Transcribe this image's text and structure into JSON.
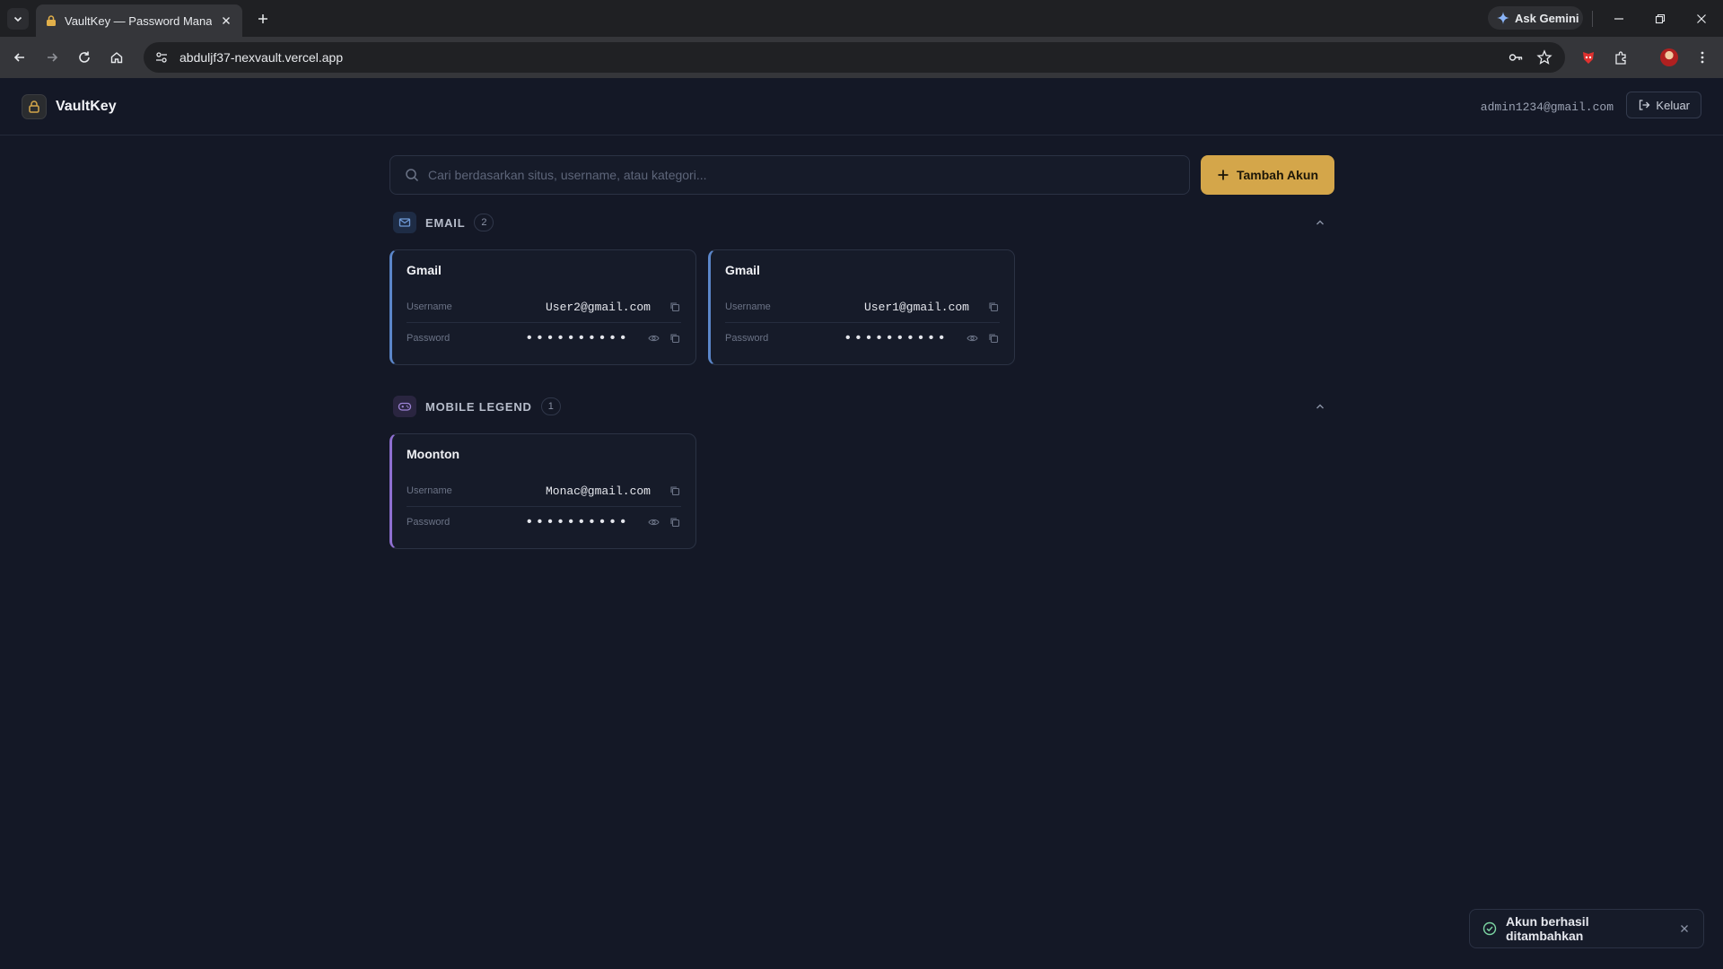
{
  "browser": {
    "tab_title": "VaultKey — Password Manager",
    "url": "abduljf37-nexvault.vercel.app",
    "gemini_label": "Ask Gemini"
  },
  "header": {
    "brand": "VaultKey",
    "user_email": "admin1234@gmail.com",
    "logout_label": "Keluar"
  },
  "search": {
    "placeholder": "Cari berdasarkan situs, username, atau kategori..."
  },
  "add_button_label": "Tambah Akun",
  "labels": {
    "username": "Username",
    "password": "Password"
  },
  "sections": [
    {
      "title": "EMAIL",
      "count": "2",
      "accent": "#5b86c9",
      "cards": [
        {
          "site": "Gmail",
          "username": "User2@gmail.com",
          "password_mask": "••••••••••"
        },
        {
          "site": "Gmail",
          "username": "User1@gmail.com",
          "password_mask": "••••••••••"
        }
      ]
    },
    {
      "title": "MOBILE LEGEND",
      "count": "1",
      "accent": "#8e6fd0",
      "cards": [
        {
          "site": "Moonton",
          "username": "Monac@gmail.com",
          "password_mask": "••••••••••"
        }
      ]
    }
  ],
  "toast": {
    "message": "Akun berhasil ditambahkan"
  },
  "colors": {
    "accent_button": "#d4a64a",
    "background": "#141826",
    "success": "#7cd6a3"
  }
}
